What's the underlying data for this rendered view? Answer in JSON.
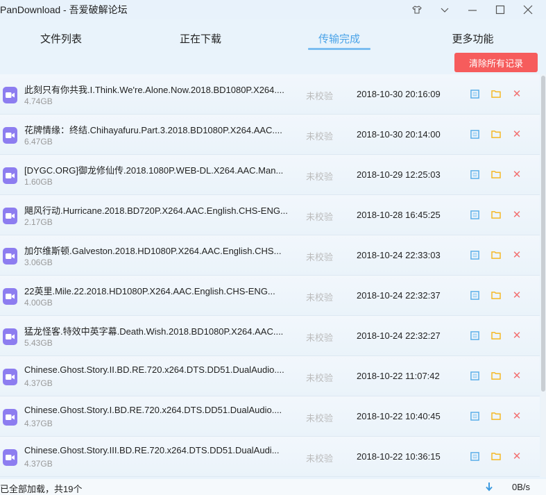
{
  "window": {
    "title": "PanDownload - 吾爱破解论坛"
  },
  "tabs": [
    {
      "label": "文件列表",
      "active": false
    },
    {
      "label": "正在下载",
      "active": false
    },
    {
      "label": "传输完成",
      "active": true
    },
    {
      "label": "更多功能",
      "active": false
    }
  ],
  "toolbar": {
    "clear_label": "清除所有记录"
  },
  "colors": {
    "accent": "#4aa3e8",
    "danger": "#f65c5c",
    "file_icon": "#8d7df0",
    "folder": "#f5b824"
  },
  "files": [
    {
      "name": "此刻只有你共我.I.Think.We're.Alone.Now.2018.BD1080P.X264....",
      "size": "4.74GB",
      "status": "未校验",
      "date": "2018-10-30 20:16:09"
    },
    {
      "name": "花牌情缘：终结.Chihayafuru.Part.3.2018.BD1080P.X264.AAC....",
      "size": "6.47GB",
      "status": "未校验",
      "date": "2018-10-30 20:14:00"
    },
    {
      "name": "[DYGC.ORG]御龙修仙传.2018.1080P.WEB-DL.X264.AAC.Man...",
      "size": "1.60GB",
      "status": "未校验",
      "date": "2018-10-29 12:25:03"
    },
    {
      "name": "飓风行动.Hurricane.2018.BD720P.X264.AAC.English.CHS-ENG...",
      "size": "2.17GB",
      "status": "未校验",
      "date": "2018-10-28 16:45:25"
    },
    {
      "name": "加尔维斯顿.Galveston.2018.HD1080P.X264.AAC.English.CHS...",
      "size": "3.06GB",
      "status": "未校验",
      "date": "2018-10-24 22:33:03"
    },
    {
      "name": "22英里.Mile.22.2018.HD1080P.X264.AAC.English.CHS-ENG...",
      "size": "4.00GB",
      "status": "未校验",
      "date": "2018-10-24 22:32:37"
    },
    {
      "name": "猛龙怪客.特效中英字幕.Death.Wish.2018.BD1080P.X264.AAC....",
      "size": "5.43GB",
      "status": "未校验",
      "date": "2018-10-24 22:32:27"
    },
    {
      "name": "Chinese.Ghost.Story.II.BD.RE.720.x264.DTS.DD51.DualAudio....",
      "size": "4.37GB",
      "status": "未校验",
      "date": "2018-10-22 11:07:42"
    },
    {
      "name": "Chinese.Ghost.Story.I.BD.RE.720.x264.DTS.DD51.DualAudio....",
      "size": "4.37GB",
      "status": "未校验",
      "date": "2018-10-22 10:40:45"
    },
    {
      "name": "Chinese.Ghost.Story.III.BD.RE.720.x264.DTS.DD51.DualAudi...",
      "size": "4.37GB",
      "status": "未校验",
      "date": "2018-10-22 10:36:15"
    }
  ],
  "actions": {
    "delete_glyph": "✕"
  },
  "statusbar": {
    "text": "已全部加载，共19个",
    "speed": "0B/s"
  }
}
